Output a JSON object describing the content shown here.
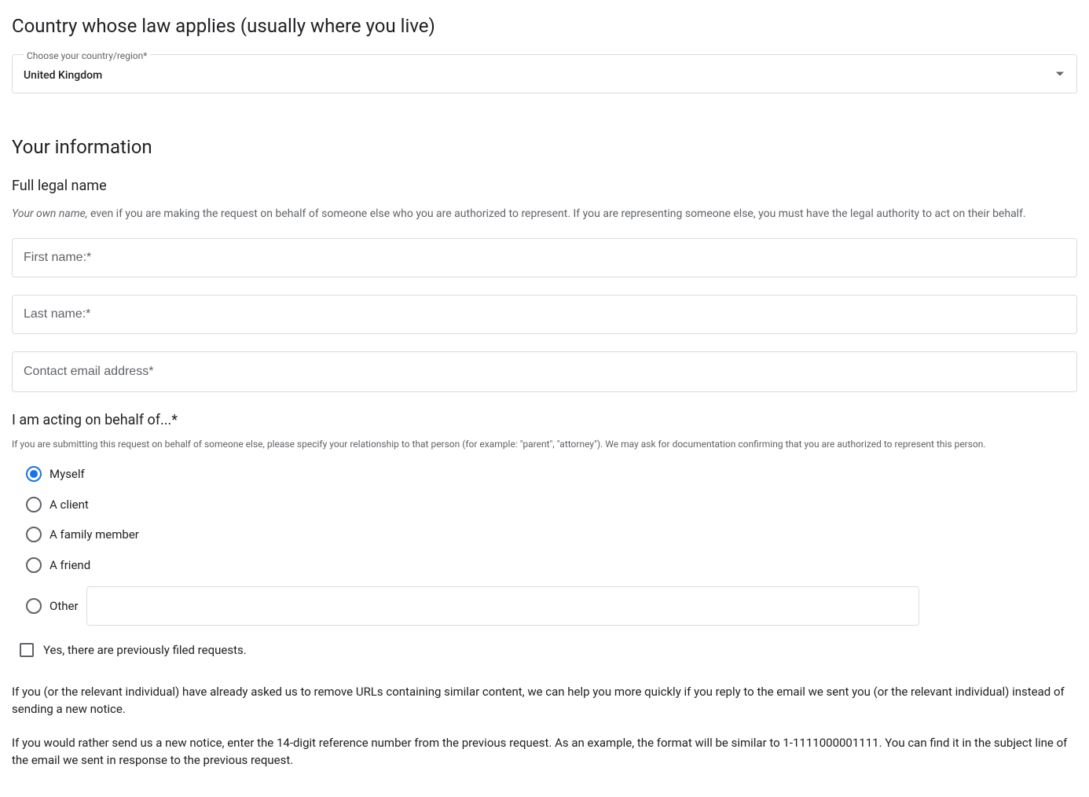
{
  "country_section": {
    "heading": "Country whose law applies (usually where you live)",
    "select_label": "Choose your country/region*",
    "select_value": "United Kingdom"
  },
  "info_section": {
    "heading": "Your information",
    "full_name_heading": "Full legal name",
    "full_name_helper_em": "Your own name,",
    "full_name_helper_rest": " even if you are making the request on behalf of someone else who you are authorized to represent. If you are representing someone else, you must have the legal authority to act on their behalf.",
    "first_name_placeholder": "First name:*",
    "last_name_placeholder": "Last name:*",
    "email_placeholder": "Contact email address*",
    "behalf_heading": "I am acting on behalf of...*",
    "behalf_helper": "If you are submitting this request on behalf of someone else, please specify your relationship to that person (for example: \"parent\", \"attorney\"). We may ask for documentation confirming that you are authorized to represent this person.",
    "radios": {
      "myself": "Myself",
      "client": "A client",
      "family": "A family member",
      "friend": "A friend",
      "other": "Other"
    },
    "checkbox_label": "Yes, there are previously filed requests.",
    "para1": "If you (or the relevant individual) have already asked us to remove URLs containing similar content, we can help you more quickly if you reply to the email we sent you (or the relevant individual) instead of sending a new notice.",
    "para2": "If you would rather send us a new notice, enter the 14-digit reference number from the previous request. As an example, the format will be similar to 1-1111000001111. You can find it in the subject line of the email we sent in response to the previous request."
  }
}
